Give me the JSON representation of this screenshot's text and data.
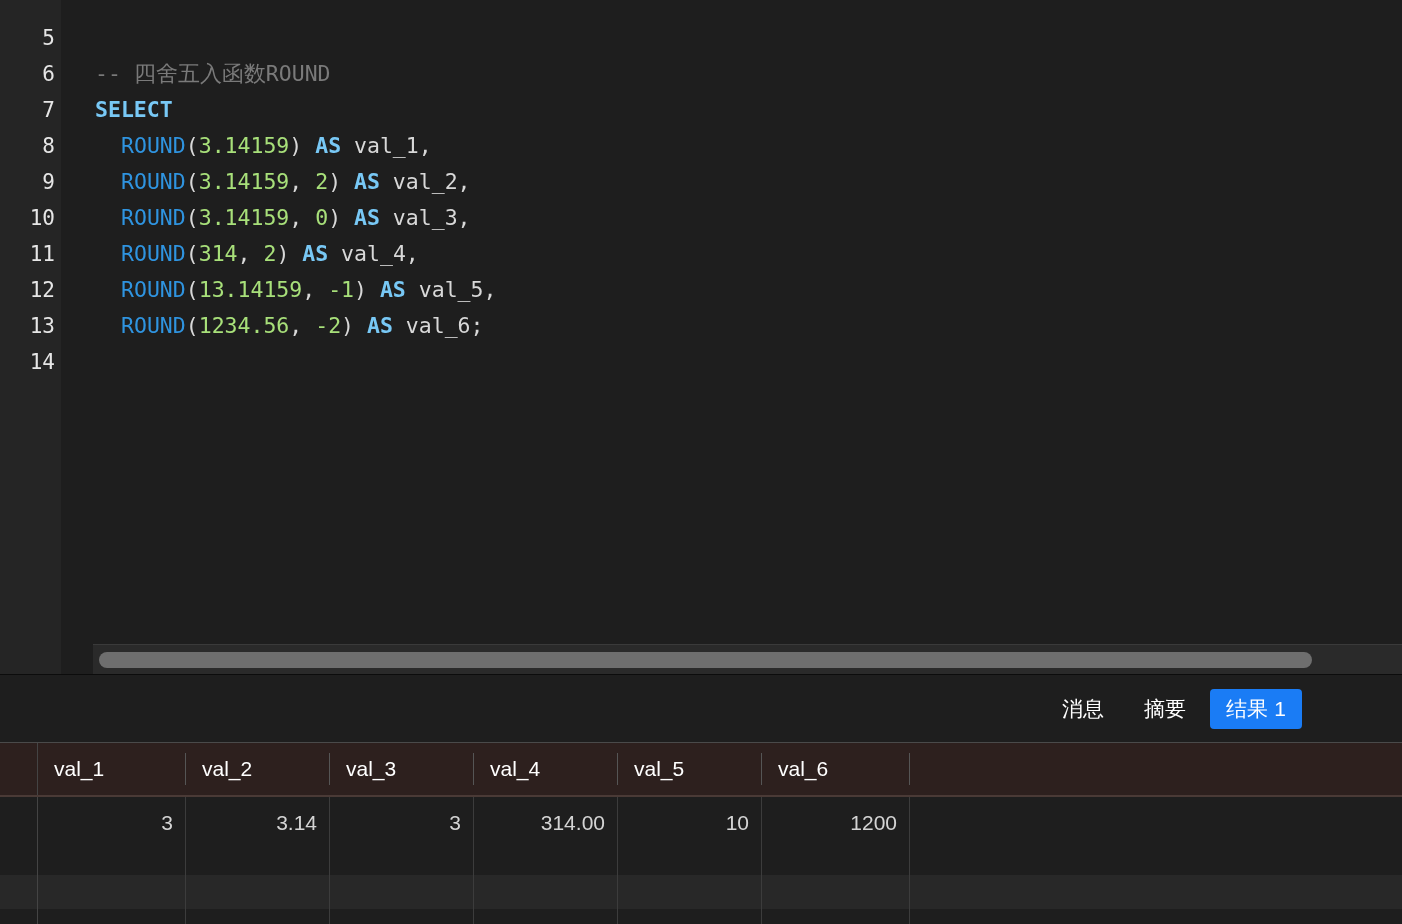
{
  "editor": {
    "lines": [
      {
        "number": "5"
      },
      {
        "number": "6",
        "indented": false,
        "tokens": [
          {
            "kind": "comment",
            "text": "-- 四舍五入函数ROUND"
          }
        ]
      },
      {
        "number": "7",
        "indented": false,
        "tokens": [
          {
            "kind": "keyword",
            "text": "SELECT"
          }
        ]
      },
      {
        "number": "8",
        "indented": true,
        "tokens": [
          {
            "kind": "function",
            "text": "ROUND"
          },
          {
            "kind": "plain",
            "text": "("
          },
          {
            "kind": "number",
            "text": "3.14159"
          },
          {
            "kind": "plain",
            "text": ") "
          },
          {
            "kind": "keyword",
            "text": "AS"
          },
          {
            "kind": "plain",
            "text": " val_1,"
          }
        ]
      },
      {
        "number": "9",
        "indented": true,
        "tokens": [
          {
            "kind": "function",
            "text": "ROUND"
          },
          {
            "kind": "plain",
            "text": "("
          },
          {
            "kind": "number",
            "text": "3.14159"
          },
          {
            "kind": "plain",
            "text": ", "
          },
          {
            "kind": "number",
            "text": "2"
          },
          {
            "kind": "plain",
            "text": ") "
          },
          {
            "kind": "keyword",
            "text": "AS"
          },
          {
            "kind": "plain",
            "text": " val_2,"
          }
        ]
      },
      {
        "number": "10",
        "indented": true,
        "tokens": [
          {
            "kind": "function",
            "text": "ROUND"
          },
          {
            "kind": "plain",
            "text": "("
          },
          {
            "kind": "number",
            "text": "3.14159"
          },
          {
            "kind": "plain",
            "text": ", "
          },
          {
            "kind": "number",
            "text": "0"
          },
          {
            "kind": "plain",
            "text": ") "
          },
          {
            "kind": "keyword",
            "text": "AS"
          },
          {
            "kind": "plain",
            "text": " val_3,"
          }
        ]
      },
      {
        "number": "11",
        "indented": true,
        "tokens": [
          {
            "kind": "function",
            "text": "ROUND"
          },
          {
            "kind": "plain",
            "text": "("
          },
          {
            "kind": "number",
            "text": "314"
          },
          {
            "kind": "plain",
            "text": ", "
          },
          {
            "kind": "number",
            "text": "2"
          },
          {
            "kind": "plain",
            "text": ") "
          },
          {
            "kind": "keyword",
            "text": "AS"
          },
          {
            "kind": "plain",
            "text": " val_4,"
          }
        ]
      },
      {
        "number": "12",
        "indented": true,
        "tokens": [
          {
            "kind": "function",
            "text": "ROUND"
          },
          {
            "kind": "plain",
            "text": "("
          },
          {
            "kind": "number",
            "text": "13.14159"
          },
          {
            "kind": "plain",
            "text": ", "
          },
          {
            "kind": "number",
            "text": "-1"
          },
          {
            "kind": "plain",
            "text": ") "
          },
          {
            "kind": "keyword",
            "text": "AS"
          },
          {
            "kind": "plain",
            "text": " val_5,"
          }
        ]
      },
      {
        "number": "13",
        "indented": true,
        "tokens": [
          {
            "kind": "function",
            "text": "ROUND"
          },
          {
            "kind": "plain",
            "text": "("
          },
          {
            "kind": "number",
            "text": "1234.56"
          },
          {
            "kind": "plain",
            "text": ", "
          },
          {
            "kind": "number",
            "text": "-2"
          },
          {
            "kind": "plain",
            "text": ") "
          },
          {
            "kind": "keyword",
            "text": "AS"
          },
          {
            "kind": "plain",
            "text": " val_6;"
          }
        ]
      },
      {
        "number": "14"
      }
    ]
  },
  "result_tabs": [
    {
      "label": "消息",
      "selected": false
    },
    {
      "label": "摘要",
      "selected": false
    },
    {
      "label": "结果 1",
      "selected": true
    }
  ],
  "table": {
    "columns": [
      "val_1",
      "val_2",
      "val_3",
      "val_4",
      "val_5",
      "val_6"
    ],
    "rows": [
      [
        "3",
        "3.14",
        "3",
        "314.00",
        "10",
        "1200"
      ]
    ]
  }
}
